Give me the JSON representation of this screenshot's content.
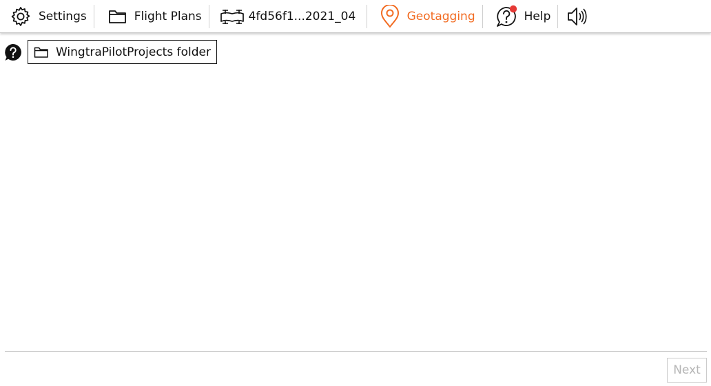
{
  "toolbar": {
    "settings_label": "Settings",
    "flight_plans_label": "Flight Plans",
    "drone_label": "4fd56f1...2021_04",
    "geotagging_label": "Geotagging",
    "help_label": "Help",
    "icons": {
      "settings": "gear-icon",
      "flight_plans": "folder-icon",
      "drone": "drone-icon",
      "geotagging": "location-pin-icon",
      "help": "help-icon",
      "sound": "speaker-icon"
    },
    "help_notification": true
  },
  "main": {
    "folder_button_label": "WingtraPilotProjects folder"
  },
  "footer": {
    "next_label": "Next",
    "next_enabled": false
  },
  "colors": {
    "accent": "#f26b21",
    "notification": "#e53935",
    "disabled_text": "#b5b5b5",
    "text": "#111111"
  }
}
